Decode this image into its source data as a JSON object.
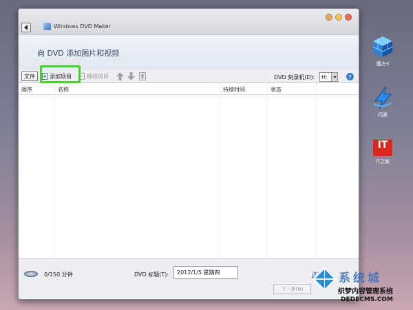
{
  "window": {
    "title": "Windows DVD Maker"
  },
  "header": {
    "text": "向 DVD 添加图片和视频"
  },
  "toolbar": {
    "file_label": "文件",
    "add_label": "添加项目",
    "remove_label": "移除项目",
    "drive_label": "DVD 刻录机(D):",
    "drive_value": "H:",
    "help_label": "?"
  },
  "list": {
    "columns": [
      "顺序",
      "名称",
      "持续时间",
      "状态"
    ]
  },
  "footer": {
    "duration": "0/150 分钟",
    "title_label": "DVD 标题(T):",
    "title_value": "2012/1/5 星期四",
    "options_label": "选项(O)",
    "next_label": "下一步(N)"
  },
  "desktop": {
    "icons": [
      {
        "label": "魔方3",
        "icon": "cube-icon"
      },
      {
        "label": "闪游",
        "icon": "flash-game-icon"
      },
      {
        "label": "IT之家",
        "icon": "it-home-icon",
        "badge": "IT"
      }
    ]
  },
  "watermark": {
    "line1": "系统城",
    "line2": "织梦内容管理系统",
    "line3": "DEDECMS.COM"
  },
  "colors": {
    "highlight": "#49d324",
    "link": "#1e56b0",
    "it_red": "#d8281e"
  }
}
